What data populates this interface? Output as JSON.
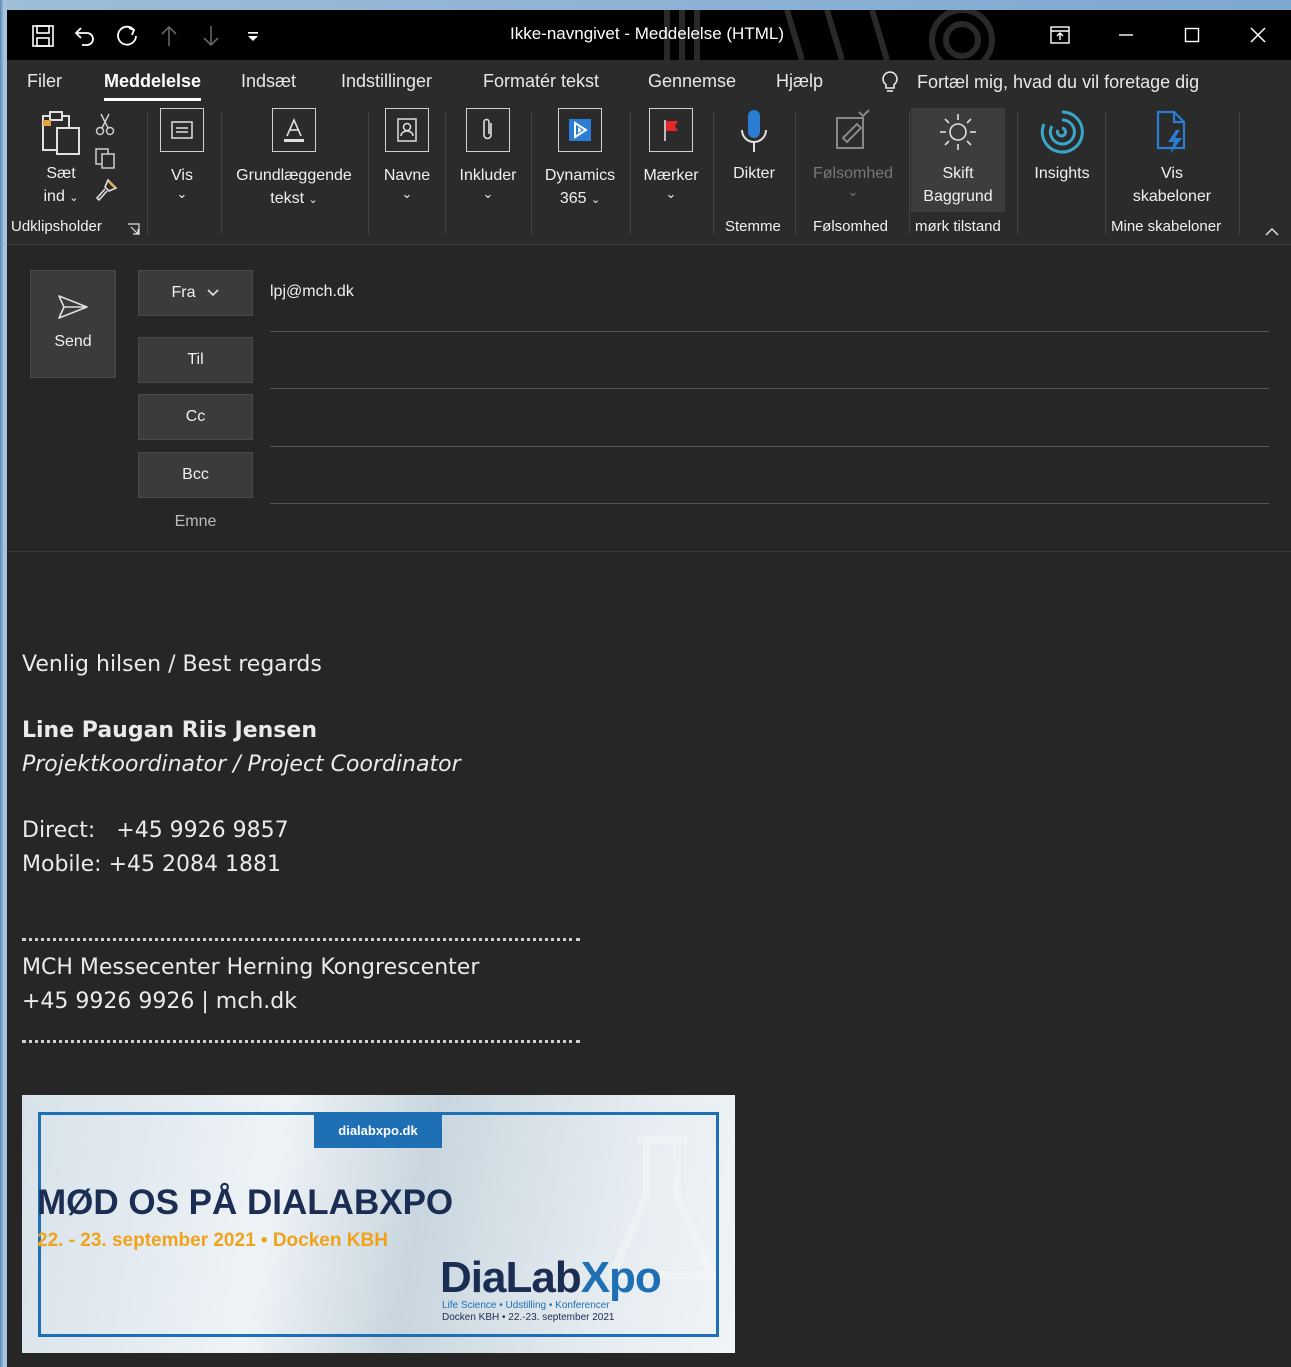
{
  "window": {
    "title": "Ikke-navngivet  -  Meddelelse (HTML)"
  },
  "tabs": [
    {
      "label": "Filer",
      "active": false
    },
    {
      "label": "Meddelelse",
      "active": true
    },
    {
      "label": "Indsæt",
      "active": false
    },
    {
      "label": "Indstillinger",
      "active": false
    },
    {
      "label": "Formatér tekst",
      "active": false
    },
    {
      "label": "Gennemse",
      "active": false
    },
    {
      "label": "Hjælp",
      "active": false
    }
  ],
  "tellme": {
    "label": "Fortæl mig, hvad du vil foretage dig"
  },
  "ribbon": {
    "paste": {
      "line1": "Sæt",
      "line2": "ind"
    },
    "view": {
      "label": "Vis"
    },
    "basic_text": {
      "line1": "Grundlæggende",
      "line2": "tekst"
    },
    "names": {
      "label": "Navne"
    },
    "include": {
      "label": "Inkluder"
    },
    "dynamics": {
      "line1": "Dynamics",
      "line2": "365"
    },
    "tags": {
      "label": "Mærker"
    },
    "dictate": {
      "label": "Dikter"
    },
    "sensitivity": {
      "label": "Følsomhed"
    },
    "switch_bg": {
      "line1": "Skift",
      "line2": "Baggrund"
    },
    "insights": {
      "label": "Insights"
    },
    "templates": {
      "line1": "Vis",
      "line2": "skabeloner"
    },
    "groups": {
      "clipboard": "Udklipsholder",
      "voice": "Stemme",
      "sensitivity": "Følsomhed",
      "dark_mode": "mørk tilstand",
      "my_templates": "Mine skabeloner"
    }
  },
  "compose": {
    "send_label": "Send",
    "from_label": "Fra",
    "from_value": "lpj@mch.dk",
    "to_label": "Til",
    "cc_label": "Cc",
    "bcc_label": "Bcc",
    "subject_label": "Emne"
  },
  "signature": {
    "greeting": "Venlig hilsen / Best regards",
    "name": "Line Paugan Riis Jensen",
    "title": "Projektkoordinator / Project Coordinator",
    "direct": "Direct:   +45 9926 9857",
    "mobile": "Mobile: +45 2084 1881",
    "company": "MCH Messecenter Herning Kongrescenter",
    "contact": "+45 9926 9926 | mch.dk"
  },
  "banner": {
    "site": "dialabxpo.dk",
    "headline": "MØD OS PÅ DIALABXPO",
    "dates": "22. - 23. september 2021 • Docken KBH",
    "logo_a": "DiaLab",
    "logo_b": "Xpo",
    "tagline": "Life Science • Udstilling • Konferencer",
    "tagline2": "Docken KBH • 22.-23. september 2021"
  },
  "colors": {
    "titlebar": "#000000",
    "ribbon": "#2b2b2b",
    "canvas": "#262626",
    "accent_blue": "#1f6fb5",
    "banner_orange": "#f0a21b"
  }
}
